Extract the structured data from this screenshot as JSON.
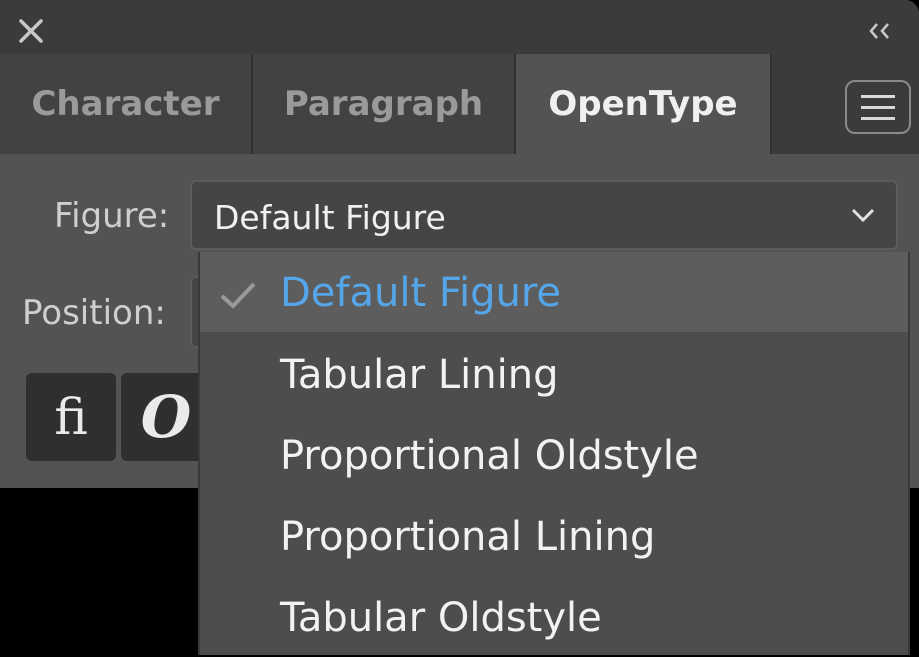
{
  "tabs": [
    {
      "label": "Character",
      "active": false
    },
    {
      "label": "Paragraph",
      "active": false
    },
    {
      "label": "OpenType",
      "active": true
    }
  ],
  "icons": {
    "close": "close-icon",
    "collapse": "double-chevron-left-icon",
    "menu": "hamburger-menu-icon",
    "dropdown": "chevron-down-icon",
    "check": "checkmark-icon"
  },
  "figure": {
    "label": "Figure:",
    "value": "Default Figure"
  },
  "position": {
    "label": "Position:"
  },
  "glyphs": {
    "ligature": "fi",
    "swash": "O"
  },
  "dropdown": {
    "options": [
      {
        "label": "Default Figure",
        "selected": true
      },
      {
        "label": "Tabular Lining",
        "selected": false
      },
      {
        "label": "Proportional Oldstyle",
        "selected": false
      },
      {
        "label": "Proportional Lining",
        "selected": false
      },
      {
        "label": "Tabular Oldstyle",
        "selected": false
      }
    ]
  },
  "colors": {
    "selected_text": "#55a6e8",
    "panel_bg": "#535353",
    "titlebar_bg": "#3b3b3b"
  }
}
